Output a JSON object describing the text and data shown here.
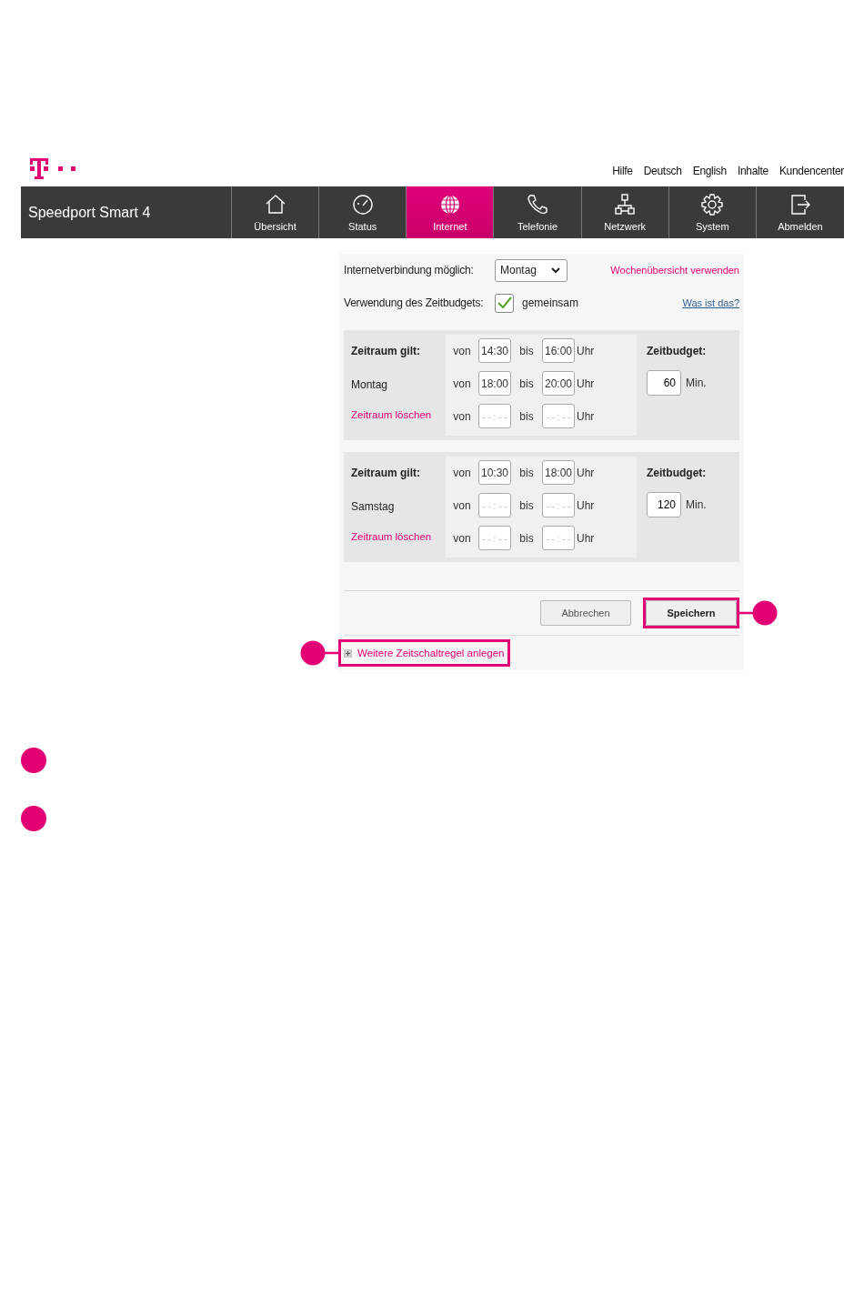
{
  "header_links": [
    "Hilfe",
    "Deutsch",
    "English",
    "Inhalte",
    "Kundencenter"
  ],
  "product_title": "Speedport Smart 4",
  "nav_tabs": [
    {
      "label": "Übersicht",
      "selected": false
    },
    {
      "label": "Status",
      "selected": false
    },
    {
      "label": "Internet",
      "selected": true
    },
    {
      "label": "Telefonie",
      "selected": false
    },
    {
      "label": "Netzwerk",
      "selected": false
    },
    {
      "label": "System",
      "selected": false
    },
    {
      "label": "Abmelden",
      "selected": false
    }
  ],
  "connection": {
    "label": "Internetverbindung möglich:",
    "day": "Montag",
    "week_link": "Wochenübersicht verwenden"
  },
  "budget_usage": {
    "label": "Verwendung des Zeitbudgets:",
    "checked": true,
    "option": "gemeinsam",
    "help_link": "Was ist das?"
  },
  "rules": [
    {
      "title": "Zeitraum gilt:",
      "day": "Montag",
      "delete_link": "Zeitraum löschen",
      "budget_label": "Zeitbudget:",
      "budget": "60",
      "budget_unit": "Min.",
      "slots": [
        {
          "from_label": "von",
          "from": "14:30",
          "to_label": "bis",
          "to": "16:00",
          "unit": "Uhr"
        },
        {
          "from_label": "von",
          "from": "18:00",
          "to_label": "bis",
          "to": "20:00",
          "unit": "Uhr"
        },
        {
          "from_label": "von",
          "from_placeholder": "- - : - -",
          "to_label": "bis",
          "to_placeholder": "- - : - -",
          "unit": "Uhr"
        }
      ]
    },
    {
      "title": "Zeitraum gilt:",
      "day": "Samstag",
      "delete_link": "Zeitraum löschen",
      "budget_label": "Zeitbudget:",
      "budget": "120",
      "budget_unit": "Min.",
      "slots": [
        {
          "from_label": "von",
          "from": "10:30",
          "to_label": "bis",
          "to": "18:00",
          "unit": "Uhr"
        },
        {
          "from_label": "von",
          "from_placeholder": "- - : - -",
          "to_label": "bis",
          "to_placeholder": "- - : - -",
          "unit": "Uhr"
        },
        {
          "from_label": "von",
          "from_placeholder": "- - : - -",
          "to_label": "bis",
          "to_placeholder": "- - : - -",
          "unit": "Uhr"
        }
      ]
    }
  ],
  "buttons": [
    {
      "label": "Abbrechen",
      "highlighted": false
    },
    {
      "label": "Speichern",
      "highlighted": true
    }
  ],
  "add_rule": {
    "label": "Weitere Zeitschaltregel anlegen",
    "highlighted": true
  }
}
